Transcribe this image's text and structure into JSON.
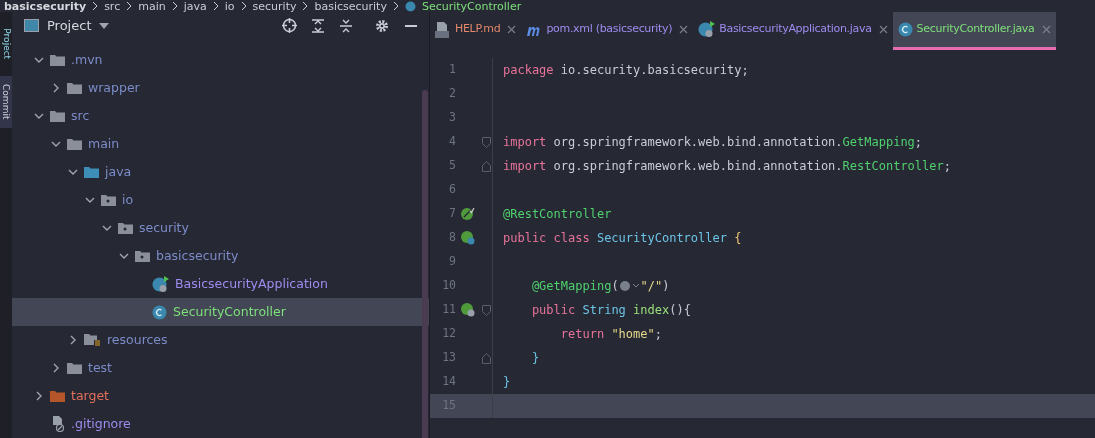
{
  "breadcrumb": [
    {
      "text": "basicsecurity",
      "kind": "root"
    },
    {
      "text": "src",
      "kind": "dir"
    },
    {
      "text": "main",
      "kind": "dir"
    },
    {
      "text": "java",
      "kind": "dir"
    },
    {
      "text": "io",
      "kind": "dir"
    },
    {
      "text": "security",
      "kind": "dir"
    },
    {
      "text": "basicsecurity",
      "kind": "dir"
    },
    {
      "text": "SecurityController",
      "kind": "class"
    }
  ],
  "side_tabs": [
    {
      "label": "Project",
      "selected": true
    },
    {
      "label": "Commit",
      "selected": false
    }
  ],
  "project_panel": {
    "title": "Project",
    "tree": [
      {
        "label": ".mvn",
        "kind": "folder",
        "expanded": true,
        "selected": false,
        "children": [
          {
            "label": "wrapper",
            "kind": "folder",
            "expanded": false,
            "selected": false
          }
        ]
      },
      {
        "label": "src",
        "kind": "folder",
        "expanded": true,
        "selected": false,
        "children": [
          {
            "label": "main",
            "kind": "folder",
            "expanded": true,
            "selected": false,
            "children": [
              {
                "label": "java",
                "kind": "source",
                "expanded": true,
                "selected": false,
                "children": [
                  {
                    "label": "io",
                    "kind": "package",
                    "expanded": true,
                    "selected": false,
                    "children": [
                      {
                        "label": "security",
                        "kind": "package",
                        "expanded": true,
                        "selected": false,
                        "children": [
                          {
                            "label": "basicsecurity",
                            "kind": "package",
                            "expanded": true,
                            "selected": false,
                            "children": [
                              {
                                "label": "BasicsecurityApplication",
                                "kind": "app",
                                "selected": false
                              },
                              {
                                "label": "SecurityController",
                                "kind": "class",
                                "selected": true
                              }
                            ]
                          }
                        ]
                      }
                    ]
                  }
                ]
              },
              {
                "label": "resources",
                "kind": "resources",
                "expanded": false,
                "selected": false
              }
            ]
          },
          {
            "label": "test",
            "kind": "folder",
            "expanded": false,
            "selected": false
          }
        ]
      },
      {
        "label": "target",
        "kind": "excluded",
        "expanded": false,
        "selected": false
      },
      {
        "label": ".gitignore",
        "kind": "ignore",
        "selected": false
      }
    ]
  },
  "tabs": [
    {
      "label": "HELP.md",
      "kind": "md",
      "selected": false
    },
    {
      "label": "pom.xml (basicsecurity)",
      "kind": "maven",
      "selected": false
    },
    {
      "label": "BasicsecurityApplication.java",
      "kind": "app",
      "selected": false
    },
    {
      "label": "SecurityController.java",
      "kind": "class",
      "selected": true
    }
  ],
  "editor": {
    "lines": [
      {
        "number": "1",
        "current": false,
        "tokens": [
          {
            "text": "package",
            "kind": "keyword"
          },
          {
            "text": " io.security.basicsecurity;",
            "kind": "plain"
          }
        ]
      },
      {
        "number": "2",
        "current": false
      },
      {
        "number": "3",
        "current": false
      },
      {
        "number": "4",
        "current": false,
        "fold_marker": {
          "kind": "start"
        },
        "tokens": [
          {
            "text": "import",
            "kind": "keyword"
          },
          {
            "text": " org.springframework.web.bind.annotation.",
            "kind": "plain"
          },
          {
            "text": "GetMapping",
            "kind": "annotation"
          },
          {
            "text": ";",
            "kind": "plain"
          }
        ]
      },
      {
        "number": "5",
        "current": false,
        "fold_marker": {
          "kind": "end"
        },
        "tokens": [
          {
            "text": "import",
            "kind": "keyword"
          },
          {
            "text": " org.springframework.web.bind.annotation.",
            "kind": "plain"
          },
          {
            "text": "RestController",
            "kind": "annotation"
          },
          {
            "text": ";",
            "kind": "plain"
          }
        ]
      },
      {
        "number": "6",
        "current": false
      },
      {
        "number": "7",
        "current": false,
        "gutter_icon": {
          "kind": "bean"
        },
        "tokens": [
          {
            "text": "@RestController",
            "kind": "annotation"
          }
        ]
      },
      {
        "number": "8",
        "current": false,
        "gutter_icon": {
          "kind": "bean-web"
        },
        "tokens": [
          {
            "text": "public class ",
            "kind": "keyword"
          },
          {
            "text": "SecurityController ",
            "kind": "type"
          },
          {
            "text": "{",
            "kind": "brace"
          }
        ]
      },
      {
        "number": "9",
        "current": false
      },
      {
        "number": "10",
        "current": false,
        "tokens": [
          {
            "text": "    @GetMapping",
            "kind": "annotation"
          },
          {
            "text": "(",
            "kind": "plain"
          },
          {
            "kind": "inlay"
          },
          {
            "text": "\"/\"",
            "kind": "string"
          },
          {
            "text": ")",
            "kind": "plain"
          }
        ]
      },
      {
        "number": "11",
        "current": false,
        "gutter_icon": {
          "kind": "bean-globe"
        },
        "fold_marker": {
          "kind": "start"
        },
        "tokens": [
          {
            "text": "    public ",
            "kind": "keyword"
          },
          {
            "text": "String ",
            "kind": "type"
          },
          {
            "text": "index",
            "kind": "method"
          },
          {
            "text": "(){",
            "kind": "plain"
          }
        ]
      },
      {
        "number": "12",
        "current": false,
        "tokens": [
          {
            "text": "        return ",
            "kind": "keyword"
          },
          {
            "text": "\"home\"",
            "kind": "string"
          },
          {
            "text": ";",
            "kind": "plain"
          }
        ]
      },
      {
        "number": "13",
        "current": false,
        "fold_marker": {
          "kind": "end"
        },
        "tokens": [
          {
            "text": "    }",
            "kind": "type"
          }
        ]
      },
      {
        "number": "14",
        "current": false,
        "tokens": [
          {
            "text": "}",
            "kind": "type"
          }
        ]
      },
      {
        "number": "15",
        "current": true
      }
    ]
  }
}
